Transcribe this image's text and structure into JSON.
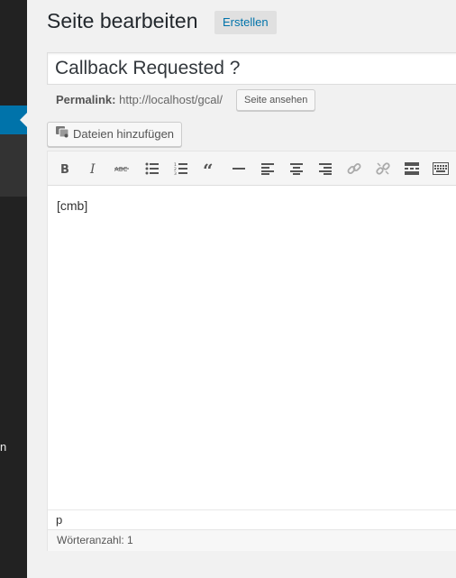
{
  "sidebar": {
    "truncated_label": "n"
  },
  "header": {
    "title": "Seite bearbeiten",
    "add_new_label": "Erstellen"
  },
  "title_field": {
    "value": "Callback Requested ?"
  },
  "permalink": {
    "label": "Permalink:",
    "url": "http://localhost/gcal/",
    "view_button": "Seite ansehen"
  },
  "media_button": {
    "label": "Dateien hinzufügen",
    "icon": "media-icon"
  },
  "editor": {
    "toolbar_icons": [
      "bold-icon",
      "italic-icon",
      "strikethrough-icon",
      "bulleted-list-icon",
      "numbered-list-icon",
      "blockquote-icon",
      "horizontal-line-icon",
      "align-left-icon",
      "align-center-icon",
      "align-right-icon",
      "insert-link-icon",
      "remove-link-icon",
      "read-more-icon",
      "toolbar-toggle-icon"
    ],
    "content": "[cmb]",
    "path": "p",
    "word_count": "Wörteranzahl: 1"
  },
  "colors": {
    "admin_bar": "#222222",
    "accent": "#0073aa",
    "background": "#f1f1f1"
  }
}
